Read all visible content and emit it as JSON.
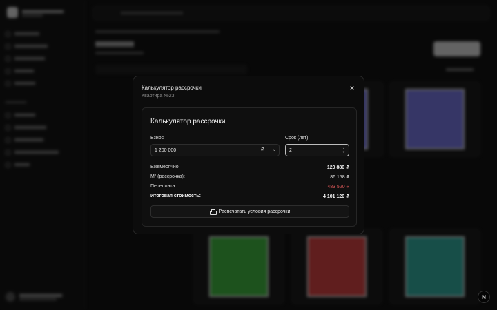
{
  "modal": {
    "title": "Калькулятор рассрочки",
    "subtitle": "Квартира №23",
    "close_icon": "close-icon"
  },
  "calculator": {
    "title": "Калькулятор рассрочки",
    "down_payment_label": "Взнос",
    "down_payment_value": "1 200 000",
    "currency": "₽",
    "term_label": "Срок (лет)",
    "term_value": "2",
    "results": [
      {
        "label": "Ежемесячно:",
        "value": "120 880 ₽"
      },
      {
        "label": "М² (рассрочка):",
        "value": "86 158 ₽"
      },
      {
        "label": "Переплата:",
        "value": "483 520 ₽",
        "color": "#e05a5a"
      },
      {
        "label": "Итоговая стоимость:",
        "value": "4 101 120 ₽"
      }
    ],
    "print_button": "Распечатать условия рассрочки"
  },
  "fab": {
    "label": "N"
  }
}
